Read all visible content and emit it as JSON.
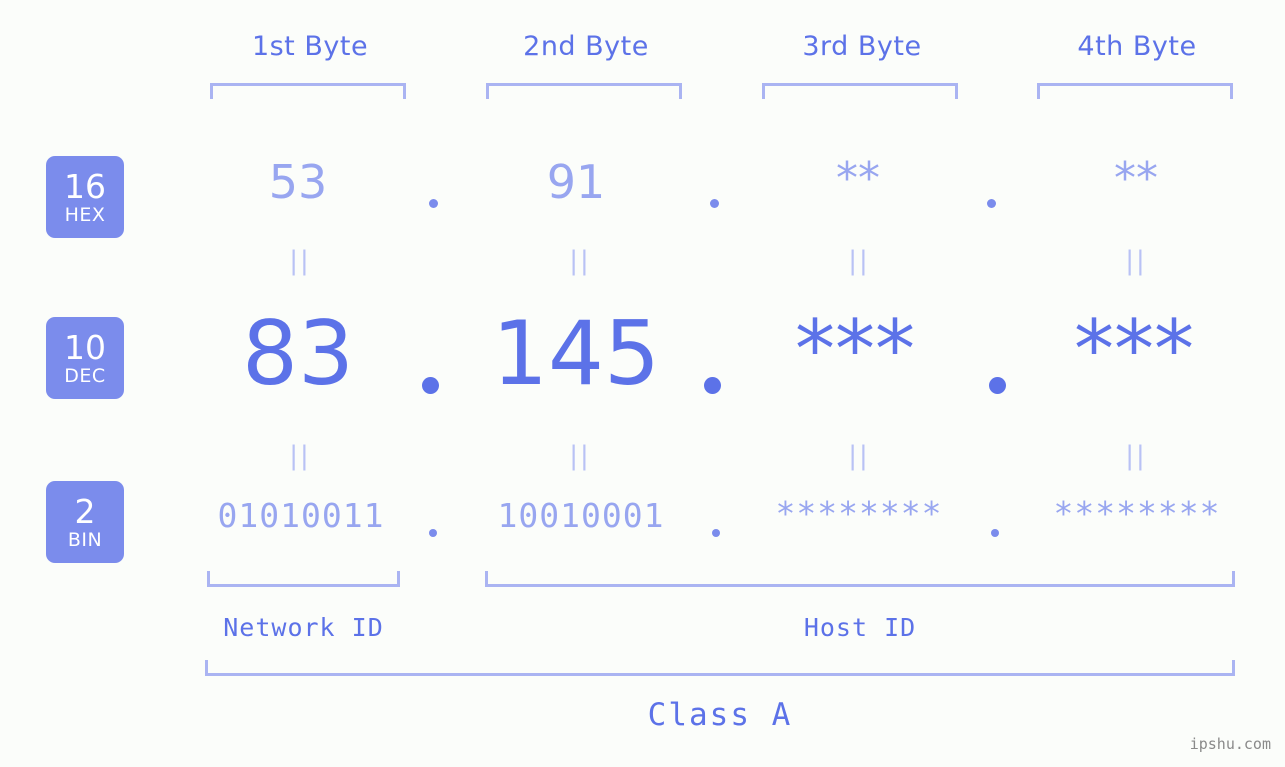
{
  "columns": [
    {
      "label": "1st Byte"
    },
    {
      "label": "2nd Byte"
    },
    {
      "label": "3rd Byte"
    },
    {
      "label": "4th Byte"
    }
  ],
  "rows": {
    "hex": {
      "badge_num": "16",
      "badge_name": "HEX",
      "values": [
        "53",
        "91",
        "**",
        "**"
      ]
    },
    "dec": {
      "badge_num": "10",
      "badge_name": "DEC",
      "values": [
        "83",
        "145",
        "***",
        "***"
      ]
    },
    "bin": {
      "badge_num": "2",
      "badge_name": "BIN",
      "values": [
        "01010011",
        "10010001",
        "********",
        "********"
      ]
    }
  },
  "separators": {
    "hex": [
      ".",
      ".",
      "."
    ],
    "dec": [
      ".",
      ".",
      "."
    ],
    "bin": [
      ".",
      ".",
      "."
    ]
  },
  "equivalence": {
    "mark": "||",
    "hex_to_dec": [
      "||",
      "||",
      "||",
      "||"
    ],
    "dec_to_bin": [
      "||",
      "||",
      "||",
      "||"
    ]
  },
  "segments": {
    "network_id": "Network ID",
    "host_id": "Host ID",
    "class": "Class A"
  },
  "watermark": "ipshu.com",
  "colors": {
    "background": "#fbfdfa",
    "accent_strong": "#5c72e8",
    "accent_mid": "#7b8cec",
    "accent_light": "#98a6f0",
    "bracket": "#aab4f2",
    "badge_bg": "#7b8cec",
    "badge_text": "#ffffff",
    "watermark": "#8a8a8a"
  }
}
